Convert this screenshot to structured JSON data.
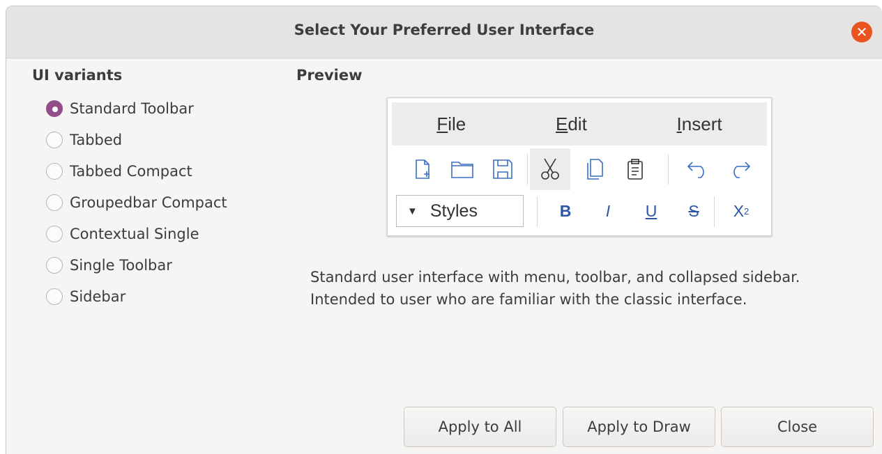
{
  "window": {
    "title": "Select Your Preferred User Interface"
  },
  "ui_variants": {
    "heading": "UI variants",
    "selected_index": 0,
    "options": [
      "Standard Toolbar",
      "Tabbed",
      "Tabbed Compact",
      "Groupedbar Compact",
      "Contextual Single",
      "Single Toolbar",
      "Sidebar"
    ]
  },
  "preview": {
    "heading": "Preview",
    "menu": {
      "file": {
        "mnemonic": "F",
        "rest": "ile"
      },
      "edit": {
        "mnemonic": "E",
        "rest": "dit"
      },
      "insert": {
        "mnemonic": "I",
        "rest": "nsert"
      }
    },
    "toolbar_icons": [
      "new-document-icon",
      "open-folder-icon",
      "save-icon",
      "cut-icon",
      "copy-icon",
      "paste-icon",
      "undo-icon",
      "redo-icon"
    ],
    "styles_dropdown": "Styles",
    "format": {
      "bold": "B",
      "italic": "I",
      "underline": "U",
      "strikethrough": "S",
      "superscript_base": "X",
      "superscript_exp": "2"
    }
  },
  "description": "Standard user interface with menu, toolbar, and collapsed sidebar. Intended to user who are familiar with the classic interface.",
  "buttons": {
    "apply_all": "Apply to All",
    "apply_draw": "Apply to Draw",
    "close": "Close"
  },
  "colors": {
    "accent": "#924d8b",
    "close_button": "#e95420",
    "format_icons": "#2a58a6"
  }
}
